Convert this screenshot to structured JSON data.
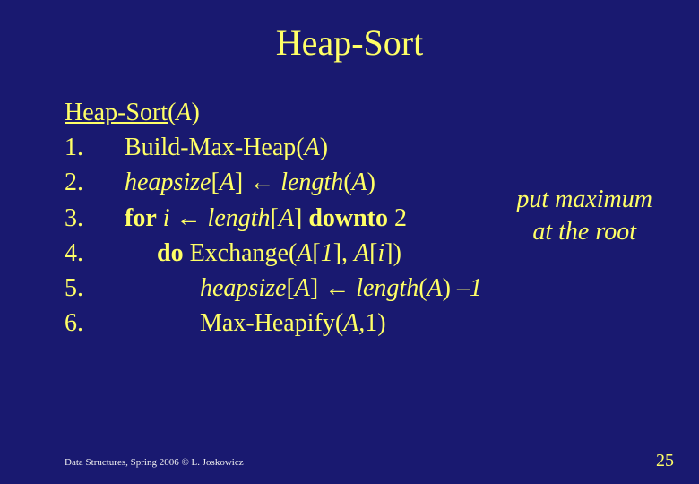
{
  "title": "Heap-Sort",
  "algo": {
    "name": "Heap-Sort",
    "arg": "A",
    "lines": {
      "l1_num": "1.",
      "l1_txt": "Build-Max-Heap(",
      "l1_arg": "A",
      "l1_close": ")",
      "l2_num": "2.",
      "l2_a": "heapsize",
      "l2_b": "[",
      "l2_c": "A",
      "l2_d": "] ",
      "l2_arrow": "←",
      "l2_e": " length",
      "l2_f": "(",
      "l2_g": "A",
      "l2_h": ")",
      "l3_num": "3.",
      "l3_a": "for",
      "l3_b": "  i ",
      "l3_arrow": "←",
      "l3_c": " length",
      "l3_d": "[",
      "l3_e": "A",
      "l3_f": "] ",
      "l3_g": "downto",
      "l3_h": " 2",
      "l4_num": "4.",
      "l4_a": "do ",
      "l4_b": "Exchange(",
      "l4_c": "A",
      "l4_d": "[",
      "l4_e": "1",
      "l4_f": "], ",
      "l4_g": "A",
      "l4_h": "[",
      "l4_i": "i",
      "l4_j": "])",
      "l5_num": "5.",
      "l5_a": "heapsize",
      "l5_b": "[",
      "l5_c": "A",
      "l5_d": "] ",
      "l5_arrow": "←",
      "l5_e": " length",
      "l5_f": "(",
      "l5_g": "A",
      "l5_h": ") ",
      "l5_i": "–",
      "l5_j": "1",
      "l6_num": "6.",
      "l6_a": "Max-Heapify(",
      "l6_b": "A,",
      "l6_c": "1)"
    }
  },
  "annotation": {
    "line1": "put maximum",
    "line2": "at the root"
  },
  "footer": {
    "left": "Data Structures, Spring 2006 © L. Joskowicz",
    "page": "25"
  }
}
